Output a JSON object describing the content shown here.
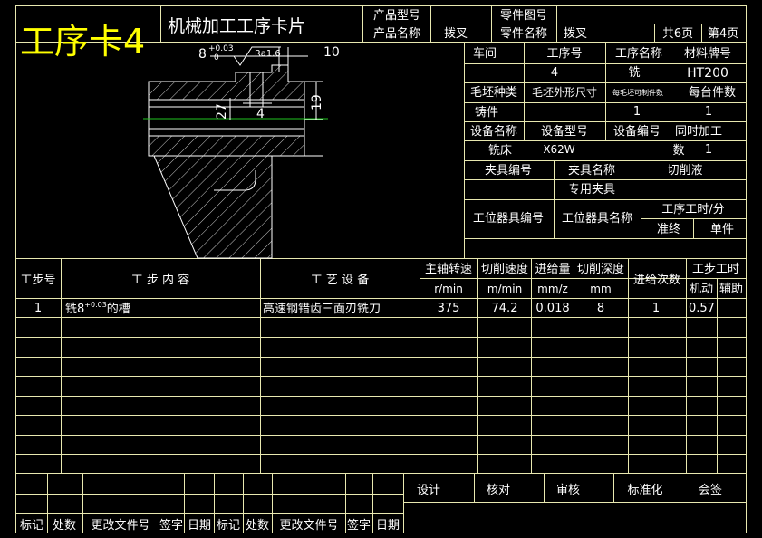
{
  "card_label": "工序卡4",
  "title": "机械加工工序卡片",
  "header": {
    "product_model_label": "产品型号",
    "product_model_value": "",
    "part_drawing_no_label": "零件图号",
    "part_drawing_no_value": "",
    "product_name_label": "产品名称",
    "product_name_value": "拨叉",
    "part_name_label": "零件名称",
    "part_name_value": "拨叉",
    "total_pages": "共6页",
    "page_no": "第4页"
  },
  "drawing": {
    "dim_width": "8",
    "dim_tol_upper": "+0.03",
    "dim_tol_lower": "0",
    "roughness": "Ra1.6",
    "dim_right": "10",
    "dim_height": "19",
    "dim_dia": "27",
    "dim_small": "4"
  },
  "info": {
    "workshop_label": "车间",
    "process_no_label": "工序号",
    "process_name_label": "工序名称",
    "material_label": "材料牌号",
    "workshop_value": "",
    "process_no_value": "4",
    "process_name_value": "铣",
    "material_value": "HT200",
    "blank_type_label": "毛坯种类",
    "blank_size_label": "毛坯外形尺寸",
    "per_blank_label": "每毛坯可制件数",
    "per_unit_label": "每台件数",
    "blank_type_value": "铸件",
    "blank_size_value": "",
    "per_blank_value": "1",
    "per_unit_value": "1",
    "equip_name_label": "设备名称",
    "equip_model_label": "设备型号",
    "equip_no_label": "设备编号",
    "simul_label": "同时加工",
    "equip_name_value": "铣床",
    "equip_model_value": "X62W",
    "equip_no_value": "",
    "simul_count_label": "数",
    "simul_count_value": "1",
    "fixture_no_label": "夹具编号",
    "fixture_name_label": "夹具名称",
    "coolant_label": "切削液",
    "fixture_no_value": "",
    "fixture_name_value": "专用夹具",
    "coolant_value": "",
    "station_tool_no_label": "工位器具编号",
    "station_tool_name_label": "工位器具名称",
    "process_time_label": "工序工时/分",
    "prep_label": "准终",
    "unit_label": "单件",
    "station_tool_no_value": "",
    "station_tool_name_value": "",
    "prep_value": "",
    "unit_value": ""
  },
  "steps_table": {
    "step_no_label": "工步号",
    "content_label": "工 步 内 容",
    "equipment_label": "工 艺 设 备",
    "spindle_label": "主轴转速",
    "speed_label": "切削速度",
    "feed_label": "进给量",
    "depth_label": "切削深度",
    "passes_label": "进给次数",
    "step_time_label": "工步工时",
    "spindle_unit": "r/min",
    "speed_unit": "m/min",
    "feed_unit": "mm/z",
    "depth_unit": "mm",
    "machine_label": "机动",
    "aux_label": "辅助",
    "rows": [
      {
        "no": "1",
        "content_prefix": "铣8",
        "content_sup": "+0.03",
        "content_suffix": "的槽",
        "equipment": "高速钢错齿三面刃铣刀",
        "spindle": "375",
        "speed": "74.2",
        "feed": "0.018",
        "depth": "8",
        "passes": "1",
        "machine": "0.57",
        "aux": ""
      }
    ]
  },
  "footer": {
    "design": "设计",
    "check": "核对",
    "review": "审核",
    "standard": "标准化",
    "countersign": "会签",
    "rev_labels": [
      "标记",
      "处数",
      "更改文件号",
      "签字",
      "日期",
      "标记",
      "处数",
      "更改文件号",
      "签字",
      "日期"
    ]
  },
  "colors": {
    "background": "#000000",
    "grid_lines": "#e8e8b0",
    "text": "#ffffff",
    "card_label": "#ffff00",
    "center_line": "#1fc41f"
  }
}
